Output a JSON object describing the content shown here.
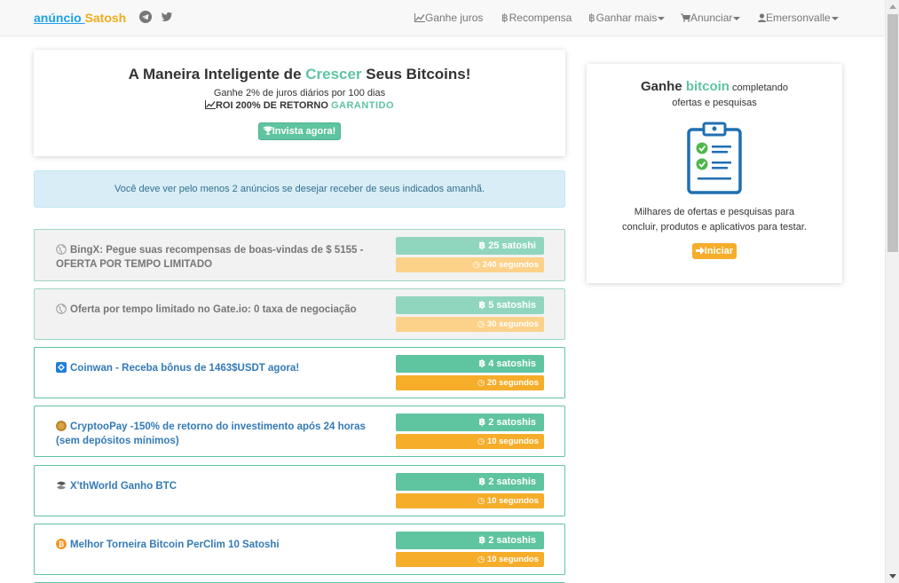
{
  "brand": {
    "part1": "anúncio ",
    "part2": "Satosh"
  },
  "nav": [
    {
      "icon": "📈",
      "label": "Ganhe juros",
      "caret": false
    },
    {
      "icon": "฿",
      "label": "Recompensa",
      "caret": false
    },
    {
      "icon": "฿",
      "label": "Ganhar mais",
      "caret": true
    },
    {
      "icon": "🛒",
      "label": "Anunciar",
      "caret": true
    },
    {
      "icon": "👤",
      "label": "Emersonvalle",
      "caret": true
    }
  ],
  "hero": {
    "title_a": "A Maneira Inteligente de ",
    "title_hl": "Crescer",
    "title_b": " Seus Bitcoins!",
    "subtitle": "Ganhe 2% de juros diários por 100 dias",
    "roi_text": "ROI 200% DE RETORNO ",
    "roi_hl": "GARANTIDO",
    "invest_button": "Invista agora!"
  },
  "info_message": "Você deve ver pelo menos 2 anúncios se desejar receber de seus indicados amanhã.",
  "ads": [
    {
      "title": "BingX: Pegue suas recompensas de boas-vindas de $ 5155 - OFERTA POR TEMPO LIMITADO",
      "reward": "25 satoshi",
      "timer": "240 segundos",
      "visited": true,
      "icon": "globe-icon"
    },
    {
      "title": "Oferta por tempo limitado no Gate.io: 0 taxa de negociação",
      "reward": "5 satoshis",
      "timer": "30 segundos",
      "visited": true,
      "icon": "globe-icon"
    },
    {
      "title": "Coinwan - Receba bônus de 1463$USDT agora!",
      "reward": "4 satoshis",
      "timer": "20 segundos",
      "visited": false,
      "icon": "coinwan-icon"
    },
    {
      "title": "CryptooPay -150% de retorno do investimento após 24 horas (sem depósitos mínimos)",
      "reward": "2 satoshis",
      "timer": "10 segundos",
      "visited": false,
      "icon": "coin-icon"
    },
    {
      "title": "X'thWorld Ganho BTC",
      "reward": "2 satoshis",
      "timer": "10 segundos",
      "visited": false,
      "icon": "xthworld-icon"
    },
    {
      "title": "Melhor Torneira Bitcoin PerClim 10 Satoshi",
      "reward": "2 satoshis",
      "timer": "10 segundos",
      "visited": false,
      "icon": "bitcoin-icon"
    }
  ],
  "side": {
    "title_a": "Ganhe ",
    "title_hl": "bitcoin",
    "title_small": " completando",
    "subtitle": "ofertas e pesquisas",
    "desc_line1": "Milhares de ofertas e pesquisas para",
    "desc_line2": "concluir, produtos e aplicativos para testar.",
    "start_button": "Iniciar"
  },
  "colors": {
    "green": "#5fc4a0",
    "orange": "#f5ad2a",
    "link": "#337ab7",
    "info_bg": "#d9edf7"
  }
}
